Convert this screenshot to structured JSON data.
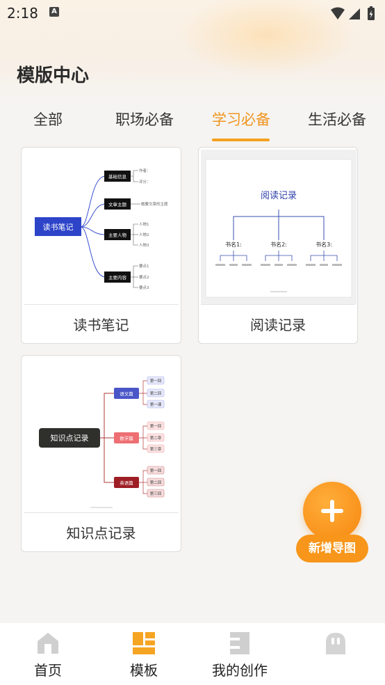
{
  "status_bar": {
    "time": "2:18",
    "notif_letter": "A"
  },
  "page": {
    "title": "模版中心"
  },
  "tabs": [
    {
      "label": "全部"
    },
    {
      "label": "职场必备"
    },
    {
      "label": "学习必备",
      "active": true
    },
    {
      "label": "生活必备"
    }
  ],
  "templates": [
    {
      "label": "读书笔记",
      "root": "读书笔记",
      "branches": [
        "基础信息",
        "文章主题",
        "主要人物",
        "主要内容"
      ],
      "leaves": [
        "作者：",
        "评分：",
        "概要文章的主题",
        "人物1",
        "人物2",
        "人物3",
        "要点1",
        "要点2",
        "要点3"
      ]
    },
    {
      "label": "阅读记录",
      "root": "阅读记录",
      "branches": [
        "书名1:",
        "书名2:",
        "书名3:"
      ]
    },
    {
      "label": "知识点记录",
      "root": "知识点记录",
      "branches": [
        "语文篇",
        "数学篇",
        "英语篇"
      ],
      "leaves": [
        "第一回",
        "第二回",
        "第一课",
        "第一回",
        "第二章",
        "第三章",
        "第一回",
        "第二回",
        "第三回"
      ]
    }
  ],
  "fab": {
    "label": "新增导图"
  },
  "bottom_nav": [
    {
      "label": "首页",
      "icon": "home-icon"
    },
    {
      "label": "模板",
      "icon": "template-icon",
      "active": true
    },
    {
      "label": "我的创作",
      "icon": "creation-icon"
    },
    {
      "label": "",
      "icon": "profile-icon"
    }
  ],
  "colors": {
    "accent": "#f4a01f",
    "accent_text": "#f0941c",
    "fab": "#f7961a",
    "nav_inactive": "#c9c9c9"
  }
}
